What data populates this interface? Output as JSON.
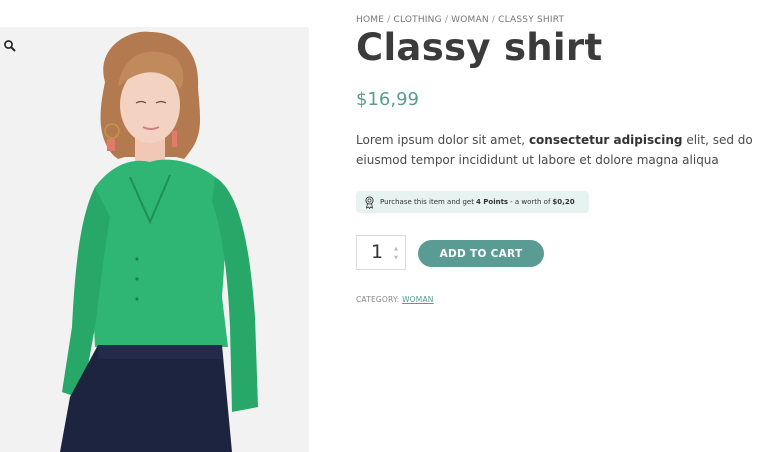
{
  "breadcrumb": {
    "items": [
      "HOME",
      "CLOTHING",
      "WOMAN",
      "CLASSY SHIRT"
    ],
    "separator": "/"
  },
  "product": {
    "title": "Classy shirt",
    "price": "$16,99",
    "description": {
      "before": "Lorem ipsum dolor sit amet, ",
      "bold": "consectetur adipiscing",
      "after": " elit, sed do eiusmod tempor incididunt ut labore et dolore magna aliqua"
    },
    "points_notice": {
      "prefix": "Purchase this item and get",
      "points": "4 Points",
      "middle": "- a worth of",
      "worth": "$0,20",
      "icon": "award-ribbon-icon"
    },
    "quantity": "1",
    "add_to_cart_label": "ADD TO CART",
    "category_label": "CATEGORY:",
    "category_value": "WOMAN"
  },
  "gallery": {
    "zoom_icon": "magnifier-icon"
  },
  "colors": {
    "accent": "#5a9c93",
    "points_bg": "#e7f3f1",
    "shirt": "#2fb574",
    "pants": "#1d2440",
    "title": "#3b3b3b"
  }
}
